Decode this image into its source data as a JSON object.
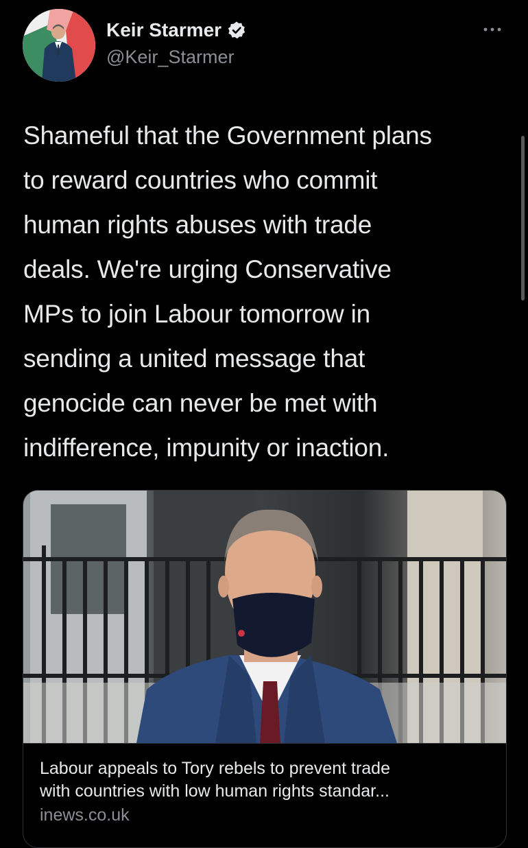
{
  "author": {
    "display_name": "Keir Starmer",
    "handle": "@Keir_Starmer",
    "verified": true
  },
  "icons": {
    "verified": "verified-badge-icon",
    "more": "more-options-icon"
  },
  "tweet": {
    "lines": [
      "Shameful that the Government plans",
      "to reward countries who commit",
      "human rights abuses with trade",
      "deals. We're urging Conservative",
      "MPs to join Labour tomorrow in",
      "sending a united message that",
      "genocide can never be met with",
      "indifference, impunity or inaction."
    ]
  },
  "card": {
    "title_lines": [
      "Labour appeals to Tory rebels to prevent trade",
      "with countries with low human rights standar..."
    ],
    "domain": "inews.co.uk"
  },
  "colors": {
    "background": "#000000",
    "text": "#e7e9ea",
    "secondary_text": "#8b8f93",
    "border": "#2f3336"
  }
}
